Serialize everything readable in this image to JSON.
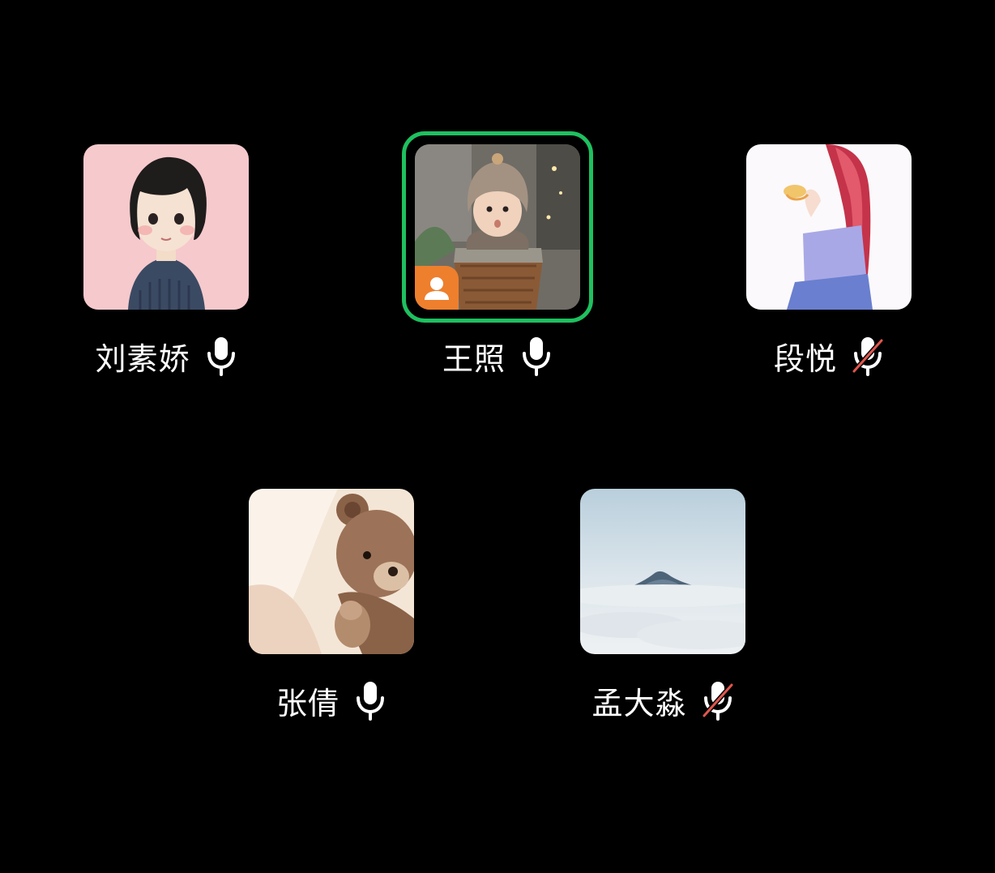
{
  "participants": [
    {
      "name": "刘素娇",
      "mic": "on",
      "speaking": false,
      "host": false,
      "avatar": "cartoon-girl-avatar"
    },
    {
      "name": "王照",
      "mic": "on",
      "speaking": true,
      "host": true,
      "avatar": "baby-in-basket-avatar"
    },
    {
      "name": "段悦",
      "mic": "muted",
      "speaking": false,
      "host": false,
      "avatar": "anime-girl-avatar"
    },
    {
      "name": "张倩",
      "mic": "on",
      "speaking": false,
      "host": false,
      "avatar": "teddy-bear-avatar"
    },
    {
      "name": "孟大淼",
      "mic": "muted",
      "speaking": false,
      "host": false,
      "avatar": "mountain-clouds-avatar"
    }
  ],
  "colors": {
    "background": "#000000",
    "speaking_ring": "#1ec05f",
    "host_badge": "#ee7f2d",
    "muted_slash": "#e0564d",
    "text": "#ffffff"
  },
  "icons": {
    "mic_on": "microphone-icon",
    "mic_muted": "microphone-muted-icon",
    "host": "host-person-icon"
  }
}
